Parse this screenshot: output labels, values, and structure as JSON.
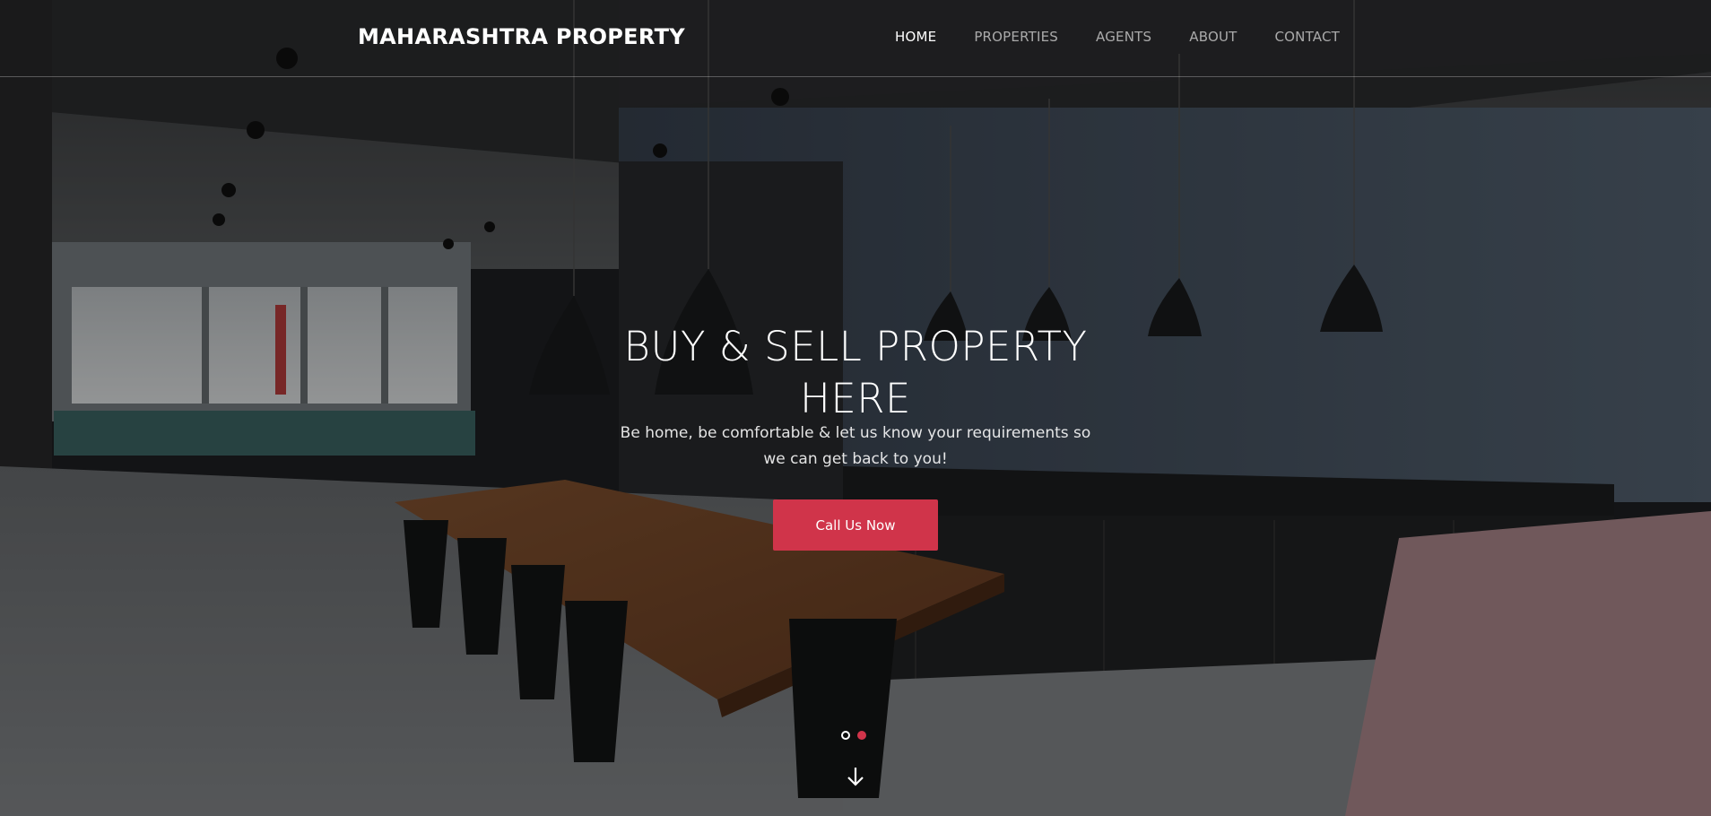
{
  "brand": {
    "name": "MAHARASHTRA PROPERTY"
  },
  "nav": {
    "items": [
      {
        "label": "HOME",
        "active": true
      },
      {
        "label": "PROPERTIES",
        "active": false
      },
      {
        "label": "AGENTS",
        "active": false
      },
      {
        "label": "ABOUT",
        "active": false
      },
      {
        "label": "CONTACT",
        "active": false
      }
    ]
  },
  "hero": {
    "title": "BUY & SELL PROPERTY HERE",
    "subtitle": "Be home, be comfortable & let us know your requirements so we can get back to you!",
    "cta_label": "Call Us Now",
    "slides": {
      "count": 2,
      "active_index": 1
    }
  },
  "colors": {
    "accent": "#d0344a",
    "text": "#ffffff",
    "nav_inactive": "rgba(255,255,255,0.62)"
  },
  "icons": {
    "scroll": "arrow-down-icon"
  }
}
